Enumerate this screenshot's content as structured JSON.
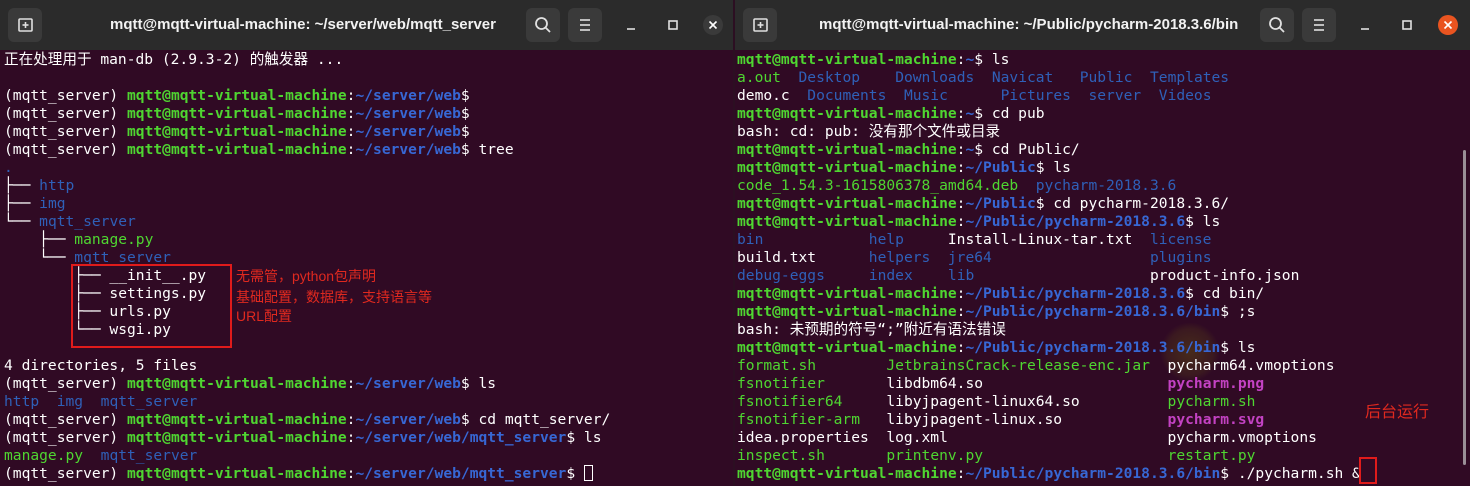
{
  "left_window": {
    "title": "mqtt@mqtt-virtual-machine: ~/server/web/mqtt_server",
    "icons": {
      "new_tab": "new-tab-icon",
      "search": "search-icon",
      "menu": "hamburger-icon",
      "minimize": "minimize-icon",
      "maximize": "maximize-icon",
      "close": "close-icon"
    },
    "close_color": "#3a3a3a",
    "lines": [
      [
        {
          "t": "正在处理用于 man-db (2.9.3-2) 的触发器 ..."
        }
      ],
      [
        {
          "t": ""
        }
      ],
      [
        {
          "t": "(mqtt_server) "
        },
        {
          "t": "mqtt@mqtt-virtual-machine",
          "c": "g"
        },
        {
          "t": ":"
        },
        {
          "t": "~/server/web",
          "c": "b"
        },
        {
          "t": "$"
        }
      ],
      [
        {
          "t": "(mqtt_server) "
        },
        {
          "t": "mqtt@mqtt-virtual-machine",
          "c": "g"
        },
        {
          "t": ":"
        },
        {
          "t": "~/server/web",
          "c": "b"
        },
        {
          "t": "$"
        }
      ],
      [
        {
          "t": "(mqtt_server) "
        },
        {
          "t": "mqtt@mqtt-virtual-machine",
          "c": "g"
        },
        {
          "t": ":"
        },
        {
          "t": "~/server/web",
          "c": "b"
        },
        {
          "t": "$"
        }
      ],
      [
        {
          "t": "(mqtt_server) "
        },
        {
          "t": "mqtt@mqtt-virtual-machine",
          "c": "g"
        },
        {
          "t": ":"
        },
        {
          "t": "~/server/web",
          "c": "b"
        },
        {
          "t": "$ tree"
        }
      ],
      [
        {
          "t": ".",
          "c": "bl"
        }
      ],
      [
        {
          "t": "├── "
        },
        {
          "t": "http",
          "c": "bl"
        }
      ],
      [
        {
          "t": "├── "
        },
        {
          "t": "img",
          "c": "bl"
        }
      ],
      [
        {
          "t": "└── "
        },
        {
          "t": "mqtt_server",
          "c": "bl"
        }
      ],
      [
        {
          "t": "    ├── "
        },
        {
          "t": "manage.py",
          "c": "gr"
        }
      ],
      [
        {
          "t": "    └── "
        },
        {
          "t": "mqtt_server",
          "c": "bl"
        }
      ],
      [
        {
          "t": "        ├── __init__.py"
        }
      ],
      [
        {
          "t": "        ├── settings.py"
        }
      ],
      [
        {
          "t": "        ├── urls.py"
        }
      ],
      [
        {
          "t": "        └── wsgi.py"
        }
      ],
      [
        {
          "t": ""
        }
      ],
      [
        {
          "t": "4 directories, 5 files"
        }
      ],
      [
        {
          "t": "(mqtt_server) "
        },
        {
          "t": "mqtt@mqtt-virtual-machine",
          "c": "g"
        },
        {
          "t": ":"
        },
        {
          "t": "~/server/web",
          "c": "b"
        },
        {
          "t": "$ ls"
        }
      ],
      [
        {
          "t": "http",
          "c": "bl"
        },
        {
          "t": "  "
        },
        {
          "t": "img",
          "c": "bl"
        },
        {
          "t": "  "
        },
        {
          "t": "mqtt_server",
          "c": "bl"
        }
      ],
      [
        {
          "t": "(mqtt_server) "
        },
        {
          "t": "mqtt@mqtt-virtual-machine",
          "c": "g"
        },
        {
          "t": ":"
        },
        {
          "t": "~/server/web",
          "c": "b"
        },
        {
          "t": "$ cd mqtt_server/"
        }
      ],
      [
        {
          "t": "(mqtt_server) "
        },
        {
          "t": "mqtt@mqtt-virtual-machine",
          "c": "g"
        },
        {
          "t": ":"
        },
        {
          "t": "~/server/web/mqtt_server",
          "c": "b"
        },
        {
          "t": "$ ls"
        }
      ],
      [
        {
          "t": "manage.py",
          "c": "gr"
        },
        {
          "t": "  "
        },
        {
          "t": "mqtt_server",
          "c": "bl"
        }
      ],
      [
        {
          "t": "(mqtt_server) "
        },
        {
          "t": "mqtt@mqtt-virtual-machine",
          "c": "g"
        },
        {
          "t": ":"
        },
        {
          "t": "~/server/web/mqtt_server",
          "c": "b"
        },
        {
          "t": "$ "
        },
        {
          "cursor": true
        }
      ]
    ],
    "annotations": [
      "无需管，python包声明",
      "基础配置，数据库，支持语言等",
      "URL配置"
    ]
  },
  "right_window": {
    "title": "mqtt@mqtt-virtual-machine: ~/Public/pycharm-2018.3.6/bin",
    "icons": {
      "new_tab": "new-tab-icon",
      "search": "search-icon",
      "menu": "hamburger-icon",
      "minimize": "minimize-icon",
      "maximize": "maximize-icon",
      "close": "close-icon"
    },
    "close_color": "#e95420",
    "lines": [
      [
        {
          "t": "mqtt@mqtt-virtual-machine",
          "c": "g"
        },
        {
          "t": ":"
        },
        {
          "t": "~",
          "c": "b"
        },
        {
          "t": "$ ls"
        }
      ],
      [
        {
          "t": "a.out",
          "c": "gr"
        },
        {
          "t": "  "
        },
        {
          "t": "Desktop",
          "c": "bl"
        },
        {
          "t": "    "
        },
        {
          "t": "Downloads",
          "c": "bl"
        },
        {
          "t": "  "
        },
        {
          "t": "Navicat",
          "c": "bl"
        },
        {
          "t": "   "
        },
        {
          "t": "Public",
          "c": "bl"
        },
        {
          "t": "  "
        },
        {
          "t": "Templates",
          "c": "bl"
        }
      ],
      [
        {
          "t": "demo.c  "
        },
        {
          "t": "Documents",
          "c": "bl"
        },
        {
          "t": "  "
        },
        {
          "t": "Music",
          "c": "bl"
        },
        {
          "t": "      "
        },
        {
          "t": "Pictures",
          "c": "bl"
        },
        {
          "t": "  "
        },
        {
          "t": "server",
          "c": "bl"
        },
        {
          "t": "  "
        },
        {
          "t": "Videos",
          "c": "bl"
        }
      ],
      [
        {
          "t": "mqtt@mqtt-virtual-machine",
          "c": "g"
        },
        {
          "t": ":"
        },
        {
          "t": "~",
          "c": "b"
        },
        {
          "t": "$ cd pub"
        }
      ],
      [
        {
          "t": "bash: cd: pub: 没有那个文件或目录"
        }
      ],
      [
        {
          "t": "mqtt@mqtt-virtual-machine",
          "c": "g"
        },
        {
          "t": ":"
        },
        {
          "t": "~",
          "c": "b"
        },
        {
          "t": "$ cd Public/"
        }
      ],
      [
        {
          "t": "mqtt@mqtt-virtual-machine",
          "c": "g"
        },
        {
          "t": ":"
        },
        {
          "t": "~/Public",
          "c": "b"
        },
        {
          "t": "$ ls"
        }
      ],
      [
        {
          "t": "code_1.54.3-1615806378_amd64.deb",
          "c": "gr"
        },
        {
          "t": "  "
        },
        {
          "t": "pycharm-2018.3.6",
          "c": "bl"
        }
      ],
      [
        {
          "t": "mqtt@mqtt-virtual-machine",
          "c": "g"
        },
        {
          "t": ":"
        },
        {
          "t": "~/Public",
          "c": "b"
        },
        {
          "t": "$ cd pycharm-2018.3.6/"
        }
      ],
      [
        {
          "t": "mqtt@mqtt-virtual-machine",
          "c": "g"
        },
        {
          "t": ":"
        },
        {
          "t": "~/Public/pycharm-2018.3.6",
          "c": "b"
        },
        {
          "t": "$ ls"
        }
      ],
      [
        {
          "t": "bin",
          "c": "bl"
        },
        {
          "t": "            "
        },
        {
          "t": "help",
          "c": "bl"
        },
        {
          "t": "     Install-Linux-tar.txt  "
        },
        {
          "t": "license",
          "c": "bl"
        }
      ],
      [
        {
          "t": "build.txt      "
        },
        {
          "t": "helpers",
          "c": "bl"
        },
        {
          "t": "  "
        },
        {
          "t": "jre64",
          "c": "bl"
        },
        {
          "t": "                  "
        },
        {
          "t": "plugins",
          "c": "bl"
        }
      ],
      [
        {
          "t": "debug-eggs",
          "c": "bl"
        },
        {
          "t": "     "
        },
        {
          "t": "index",
          "c": "bl"
        },
        {
          "t": "    "
        },
        {
          "t": "lib",
          "c": "bl"
        },
        {
          "t": "                    product-info.json"
        }
      ],
      [
        {
          "t": "mqtt@mqtt-virtual-machine",
          "c": "g"
        },
        {
          "t": ":"
        },
        {
          "t": "~/Public/pycharm-2018.3.6",
          "c": "b"
        },
        {
          "t": "$ cd bin/"
        }
      ],
      [
        {
          "t": "mqtt@mqtt-virtual-machine",
          "c": "g"
        },
        {
          "t": ":"
        },
        {
          "t": "~/Public/pycharm-2018.3.6/bin",
          "c": "b"
        },
        {
          "t": "$ ;s"
        }
      ],
      [
        {
          "t": "bash: 未预期的符号“;”附近有语法错误"
        }
      ],
      [
        {
          "t": "mqtt@mqtt-virtual-machine",
          "c": "g"
        },
        {
          "t": ":"
        },
        {
          "t": "~/Public/pycharm-2018.3.6/bin",
          "c": "b"
        },
        {
          "t": "$ ls"
        }
      ],
      [
        {
          "t": "format.sh",
          "c": "gr"
        },
        {
          "t": "        "
        },
        {
          "t": "JetbrainsCrack-release-enc.jar",
          "c": "gr"
        },
        {
          "t": "  pycharm64.vmoptions"
        }
      ],
      [
        {
          "t": "fsnotifier",
          "c": "gr"
        },
        {
          "t": "       libdbm64.so                     "
        },
        {
          "t": "pycharm.png",
          "c": "mg"
        }
      ],
      [
        {
          "t": "fsnotifier64",
          "c": "gr"
        },
        {
          "t": "     libyjpagent-linux64.so          "
        },
        {
          "t": "pycharm.sh",
          "c": "gr"
        }
      ],
      [
        {
          "t": "fsnotifier-arm",
          "c": "gr"
        },
        {
          "t": "   libyjpagent-linux.so            "
        },
        {
          "t": "pycharm.svg",
          "c": "mg"
        }
      ],
      [
        {
          "t": "idea.properties  log.xml                         pycharm.vmoptions"
        }
      ],
      [
        {
          "t": "inspect.sh",
          "c": "gr"
        },
        {
          "t": "       "
        },
        {
          "t": "printenv.py",
          "c": "gr"
        },
        {
          "t": "                     "
        },
        {
          "t": "restart.py",
          "c": "gr"
        }
      ],
      [
        {
          "t": "mqtt@mqtt-virtual-machine",
          "c": "g"
        },
        {
          "t": ":"
        },
        {
          "t": "~/Public/pycharm-2018.3.6/bin",
          "c": "b"
        },
        {
          "t": "$ ./pycharm.sh &"
        }
      ]
    ],
    "annotations": [
      "后台运行"
    ]
  }
}
